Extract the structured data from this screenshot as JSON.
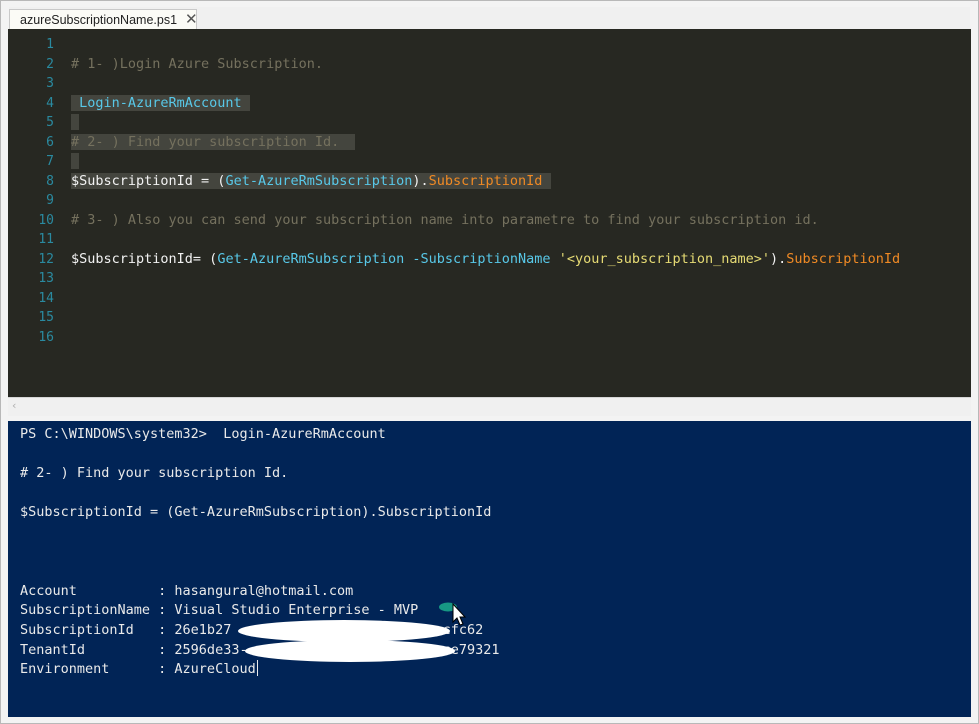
{
  "tab": {
    "title": "azureSubscriptionName.ps1",
    "close_glyph": "✕"
  },
  "editor": {
    "line_numbers": [
      "1",
      "2",
      "3",
      "4",
      "5",
      "6",
      "7",
      "8",
      "9",
      "10",
      "11",
      "12",
      "13",
      "14",
      "15",
      "16"
    ],
    "lines": [
      [],
      [
        {
          "t": "# 1- )Login Azure Subscription.",
          "c": "comment"
        }
      ],
      [],
      [
        {
          "t": " Login-AzureRmAccount ",
          "c": "cmd",
          "hl": true
        }
      ],
      [
        {
          "t": " ",
          "c": "plain",
          "hl": true
        }
      ],
      [
        {
          "t": "# 2- ) Find your subscription Id.  ",
          "c": "comment",
          "hl": true
        }
      ],
      [
        {
          "t": " ",
          "c": "plain",
          "hl": true
        }
      ],
      [
        {
          "t": "$SubscriptionId = (",
          "c": "var",
          "hl": true
        },
        {
          "t": "Get-AzureRmSubscription",
          "c": "cmd",
          "hl": true
        },
        {
          "t": ").",
          "c": "plain",
          "hl": true
        },
        {
          "t": "SubscriptionId ",
          "c": "prop",
          "hl": true
        }
      ],
      [],
      [
        {
          "t": "# 3- ) Also you can send your subscription name into parametre to find your subscription id.",
          "c": "comment"
        }
      ],
      [],
      [
        {
          "t": "$SubscriptionId= (",
          "c": "var"
        },
        {
          "t": "Get-AzureRmSubscription",
          "c": "cmd"
        },
        {
          "t": " ",
          "c": "plain"
        },
        {
          "t": "-SubscriptionName",
          "c": "cmd"
        },
        {
          "t": " ",
          "c": "plain"
        },
        {
          "t": "'<your_subscription_name>'",
          "c": "str"
        },
        {
          "t": ").",
          "c": "plain"
        },
        {
          "t": "SubscriptionId",
          "c": "prop"
        }
      ],
      [],
      [],
      [],
      []
    ]
  },
  "scrollbar": {
    "left_arrow": "‹"
  },
  "console": {
    "lines": [
      "PS C:\\WINDOWS\\system32>  Login-AzureRmAccount",
      "",
      "# 2- ) Find your subscription Id.",
      "",
      "$SubscriptionId = (Get-AzureRmSubscription).SubscriptionId",
      "",
      "",
      "",
      "Account          : hasangural@hotmail.com",
      "SubscriptionName : Visual Studio Enterprise - MVP",
      "SubscriptionId   : 26e1b27                         acfc62",
      "TenantId         : 2596de33-                        ce79321",
      "Environment      : AzureCloud"
    ]
  },
  "colors": {
    "editor_bg": "#272822",
    "console_bg": "#012456",
    "comment": "#75715e",
    "command": "#58c8e8",
    "property": "#f08a24",
    "string": "#e6db74"
  }
}
